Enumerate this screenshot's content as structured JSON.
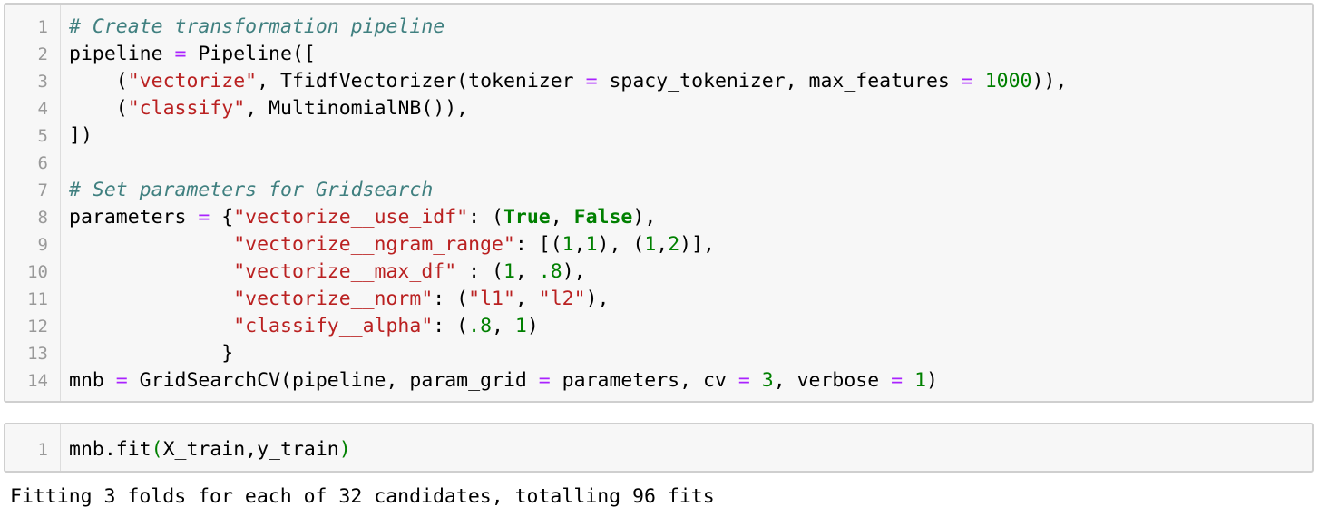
{
  "cells": [
    {
      "lines": [
        {
          "n": "1",
          "tokens": [
            {
              "t": "# Create transformation pipeline",
              "c": "cm"
            }
          ]
        },
        {
          "n": "2",
          "tokens": [
            {
              "t": "pipeline ",
              "c": ""
            },
            {
              "t": "=",
              "c": "op"
            },
            {
              "t": " Pipeline([",
              "c": ""
            }
          ]
        },
        {
          "n": "3",
          "tokens": [
            {
              "t": "    (",
              "c": ""
            },
            {
              "t": "\"vectorize\"",
              "c": "st"
            },
            {
              "t": ", TfidfVectorizer(tokenizer ",
              "c": ""
            },
            {
              "t": "=",
              "c": "op"
            },
            {
              "t": " spacy_tokenizer, max_features ",
              "c": ""
            },
            {
              "t": "=",
              "c": "op"
            },
            {
              "t": " ",
              "c": ""
            },
            {
              "t": "1000",
              "c": "nu"
            },
            {
              "t": ")),",
              "c": ""
            }
          ]
        },
        {
          "n": "4",
          "tokens": [
            {
              "t": "    (",
              "c": ""
            },
            {
              "t": "\"classify\"",
              "c": "st"
            },
            {
              "t": ", MultinomialNB()),",
              "c": ""
            }
          ]
        },
        {
          "n": "5",
          "tokens": [
            {
              "t": "])",
              "c": ""
            }
          ]
        },
        {
          "n": "6",
          "tokens": []
        },
        {
          "n": "7",
          "tokens": [
            {
              "t": "# Set parameters for Gridsearch",
              "c": "cm"
            }
          ]
        },
        {
          "n": "8",
          "tokens": [
            {
              "t": "parameters ",
              "c": ""
            },
            {
              "t": "=",
              "c": "op"
            },
            {
              "t": " {",
              "c": ""
            },
            {
              "t": "\"vectorize__use_idf\"",
              "c": "st"
            },
            {
              "t": ": (",
              "c": ""
            },
            {
              "t": "True",
              "c": "kw"
            },
            {
              "t": ", ",
              "c": ""
            },
            {
              "t": "False",
              "c": "kw"
            },
            {
              "t": "),",
              "c": ""
            }
          ]
        },
        {
          "n": "9",
          "tokens": [
            {
              "t": "              ",
              "c": ""
            },
            {
              "t": "\"vectorize__ngram_range\"",
              "c": "st"
            },
            {
              "t": ": [(",
              "c": ""
            },
            {
              "t": "1",
              "c": "nu"
            },
            {
              "t": ",",
              "c": ""
            },
            {
              "t": "1",
              "c": "nu"
            },
            {
              "t": "), (",
              "c": ""
            },
            {
              "t": "1",
              "c": "nu"
            },
            {
              "t": ",",
              "c": ""
            },
            {
              "t": "2",
              "c": "nu"
            },
            {
              "t": ")],",
              "c": ""
            }
          ]
        },
        {
          "n": "10",
          "tokens": [
            {
              "t": "              ",
              "c": ""
            },
            {
              "t": "\"vectorize__max_df\"",
              "c": "st"
            },
            {
              "t": " : (",
              "c": ""
            },
            {
              "t": "1",
              "c": "nu"
            },
            {
              "t": ", ",
              "c": ""
            },
            {
              "t": ".8",
              "c": "nu"
            },
            {
              "t": "),",
              "c": ""
            }
          ]
        },
        {
          "n": "11",
          "tokens": [
            {
              "t": "              ",
              "c": ""
            },
            {
              "t": "\"vectorize__norm\"",
              "c": "st"
            },
            {
              "t": ": (",
              "c": ""
            },
            {
              "t": "\"l1\"",
              "c": "st"
            },
            {
              "t": ", ",
              "c": ""
            },
            {
              "t": "\"l2\"",
              "c": "st"
            },
            {
              "t": "),",
              "c": ""
            }
          ]
        },
        {
          "n": "12",
          "tokens": [
            {
              "t": "              ",
              "c": ""
            },
            {
              "t": "\"classify__alpha\"",
              "c": "st"
            },
            {
              "t": ": (",
              "c": ""
            },
            {
              "t": ".8",
              "c": "nu"
            },
            {
              "t": ", ",
              "c": ""
            },
            {
              "t": "1",
              "c": "nu"
            },
            {
              "t": ")",
              "c": ""
            }
          ]
        },
        {
          "n": "13",
          "tokens": [
            {
              "t": "             }",
              "c": ""
            }
          ]
        },
        {
          "n": "14",
          "tokens": [
            {
              "t": "mnb ",
              "c": ""
            },
            {
              "t": "=",
              "c": "op"
            },
            {
              "t": " GridSearchCV(pipeline, param_grid ",
              "c": ""
            },
            {
              "t": "=",
              "c": "op"
            },
            {
              "t": " parameters, cv ",
              "c": ""
            },
            {
              "t": "=",
              "c": "op"
            },
            {
              "t": " ",
              "c": ""
            },
            {
              "t": "3",
              "c": "nu"
            },
            {
              "t": ", verbose ",
              "c": ""
            },
            {
              "t": "=",
              "c": "op"
            },
            {
              "t": " ",
              "c": ""
            },
            {
              "t": "1",
              "c": "nu"
            },
            {
              "t": ")",
              "c": ""
            }
          ]
        }
      ]
    },
    {
      "lines": [
        {
          "n": "1",
          "tokens": [
            {
              "t": "mnb.fit",
              "c": ""
            },
            {
              "t": "(",
              "c": "nu"
            },
            {
              "t": "X_train,y_train",
              "c": ""
            },
            {
              "t": ")",
              "c": "nu"
            }
          ]
        }
      ]
    }
  ],
  "output": {
    "text": "Fitting 3 folds for each of 32 candidates, totalling 96 fits"
  },
  "colors": {
    "comment": "#408080",
    "string": "#ba2121",
    "operator": "#aa22ff",
    "number": "#008000",
    "keyword": "#008000",
    "line_number": "#999999",
    "cell_background": "#f7f7f7",
    "cell_border": "#cfcfcf"
  }
}
